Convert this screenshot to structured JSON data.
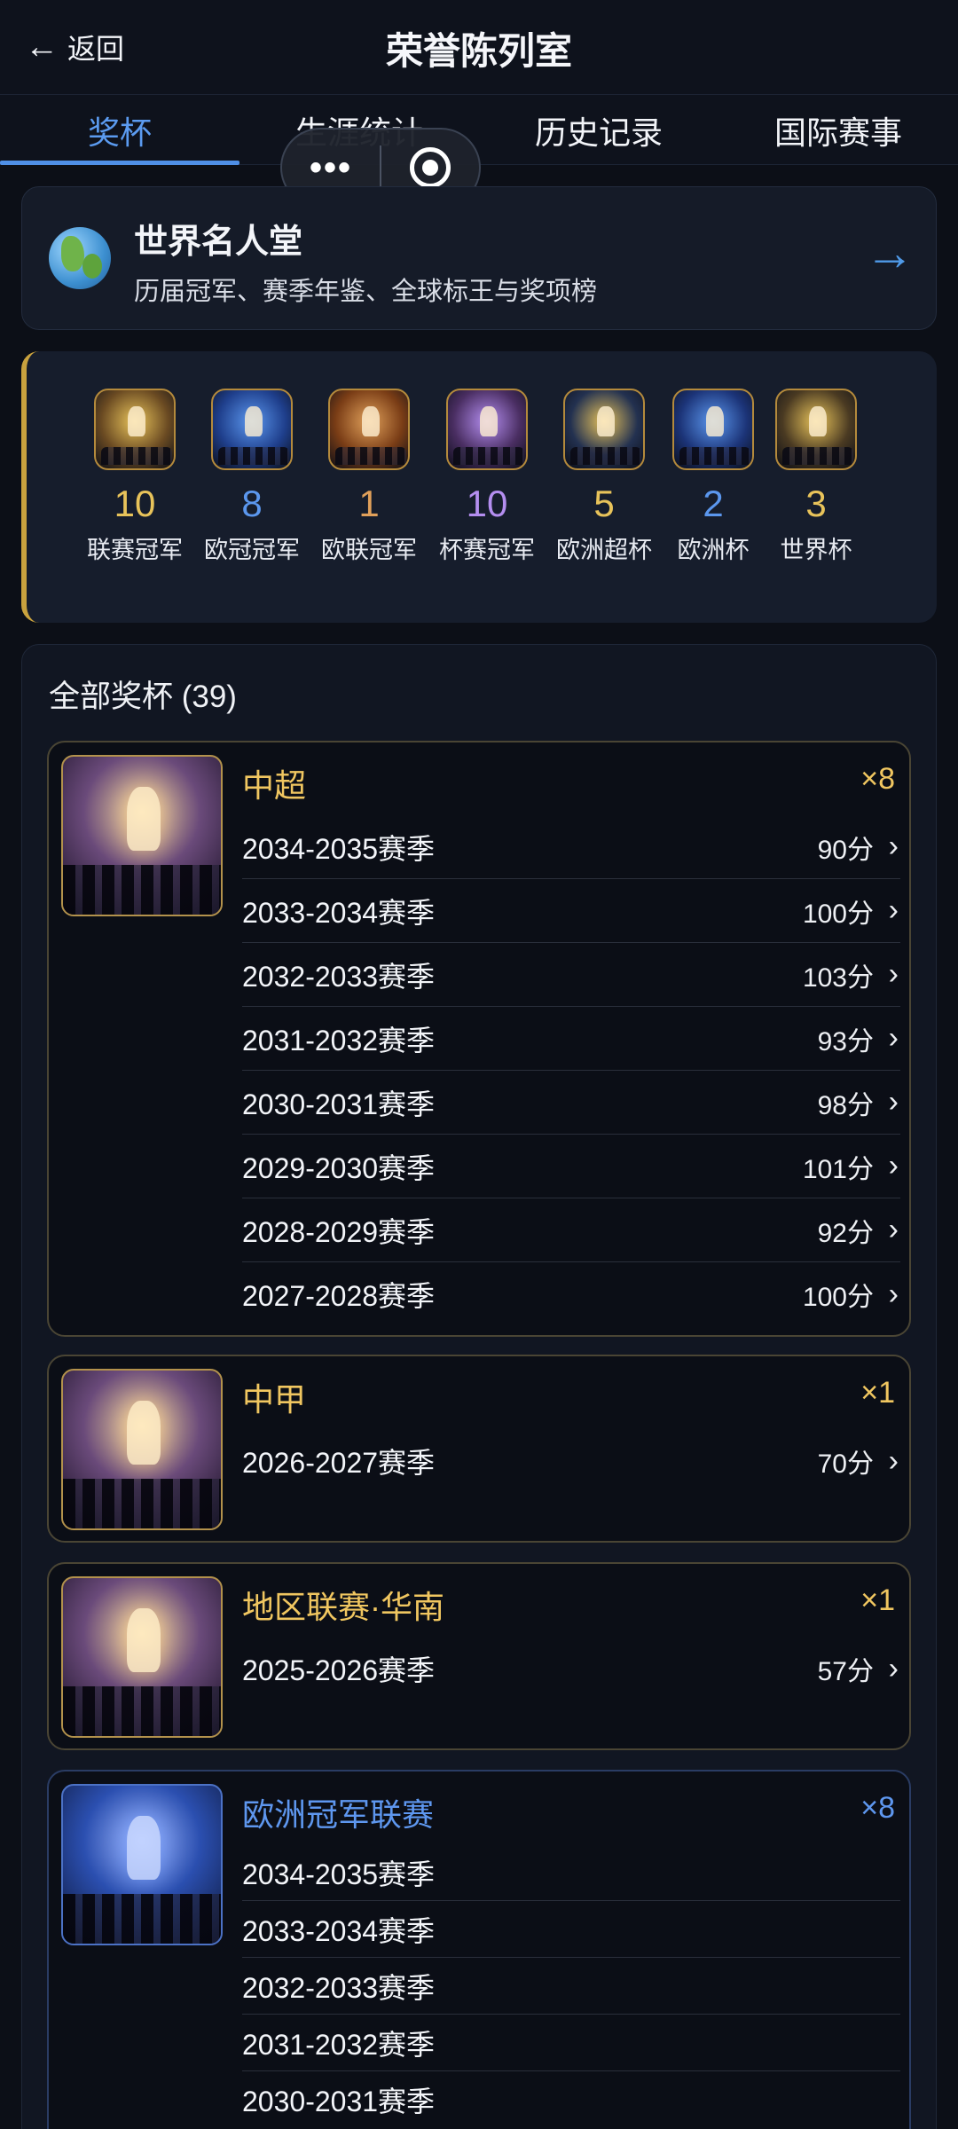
{
  "header": {
    "back_label": "返回",
    "title": "荣誉陈列室"
  },
  "tabs": [
    {
      "label": "奖杯",
      "active": true
    },
    {
      "label": "生涯统计",
      "active": false
    },
    {
      "label": "历史记录",
      "active": false
    },
    {
      "label": "国际赛事",
      "active": false
    }
  ],
  "capsule": {
    "more_icon": "more-dots-icon",
    "record_icon": "record-icon"
  },
  "hall_of_fame": {
    "title": "世界名人堂",
    "subtitle": "历届冠军、赛季年鉴、全球标王与奖项榜",
    "icon": "globe-icon"
  },
  "summary": [
    {
      "count": "10",
      "label": "联赛冠军",
      "color": "#e8c35a",
      "tint": "#6a4a22"
    },
    {
      "count": "8",
      "label": "欧冠冠军",
      "color": "#5b97ee",
      "tint": "#1f3f8c"
    },
    {
      "count": "1",
      "label": "欧联冠军",
      "color": "#e0a05a",
      "tint": "#7a3d16"
    },
    {
      "count": "10",
      "label": "杯赛冠军",
      "color": "#b48ef0",
      "tint": "#4a2e62"
    },
    {
      "count": "5",
      "label": "欧洲超杯",
      "color": "#e8c35a",
      "tint": "#233150"
    },
    {
      "count": "2",
      "label": "欧洲杯",
      "color": "#5b97ee",
      "tint": "#1c3478"
    },
    {
      "count": "3",
      "label": "世界杯",
      "color": "#e8c35a",
      "tint": "#4a3a22"
    }
  ],
  "trophies": {
    "title": "全部奖杯 (39)",
    "groups": [
      {
        "name": "中超",
        "count": "×8",
        "rows": [
          {
            "season": "2034-2035赛季",
            "points": "90分"
          },
          {
            "season": "2033-2034赛季",
            "points": "100分"
          },
          {
            "season": "2032-2033赛季",
            "points": "103分"
          },
          {
            "season": "2031-2032赛季",
            "points": "93分"
          },
          {
            "season": "2030-2031赛季",
            "points": "98分"
          },
          {
            "season": "2029-2030赛季",
            "points": "101分"
          },
          {
            "season": "2028-2029赛季",
            "points": "92分"
          },
          {
            "season": "2027-2028赛季",
            "points": "100分"
          }
        ]
      },
      {
        "name": "中甲",
        "count": "×1",
        "rows": [
          {
            "season": "2026-2027赛季",
            "points": "70分"
          }
        ]
      },
      {
        "name": "地区联赛·华南",
        "count": "×1",
        "rows": [
          {
            "season": "2025-2026赛季",
            "points": "57分"
          }
        ]
      },
      {
        "name": "欧洲冠军联赛",
        "count": "×8",
        "rows": [
          {
            "season": "2034-2035赛季"
          },
          {
            "season": "2033-2034赛季"
          },
          {
            "season": "2032-2033赛季"
          },
          {
            "season": "2031-2032赛季"
          },
          {
            "season": "2030-2031赛季"
          }
        ]
      }
    ]
  }
}
